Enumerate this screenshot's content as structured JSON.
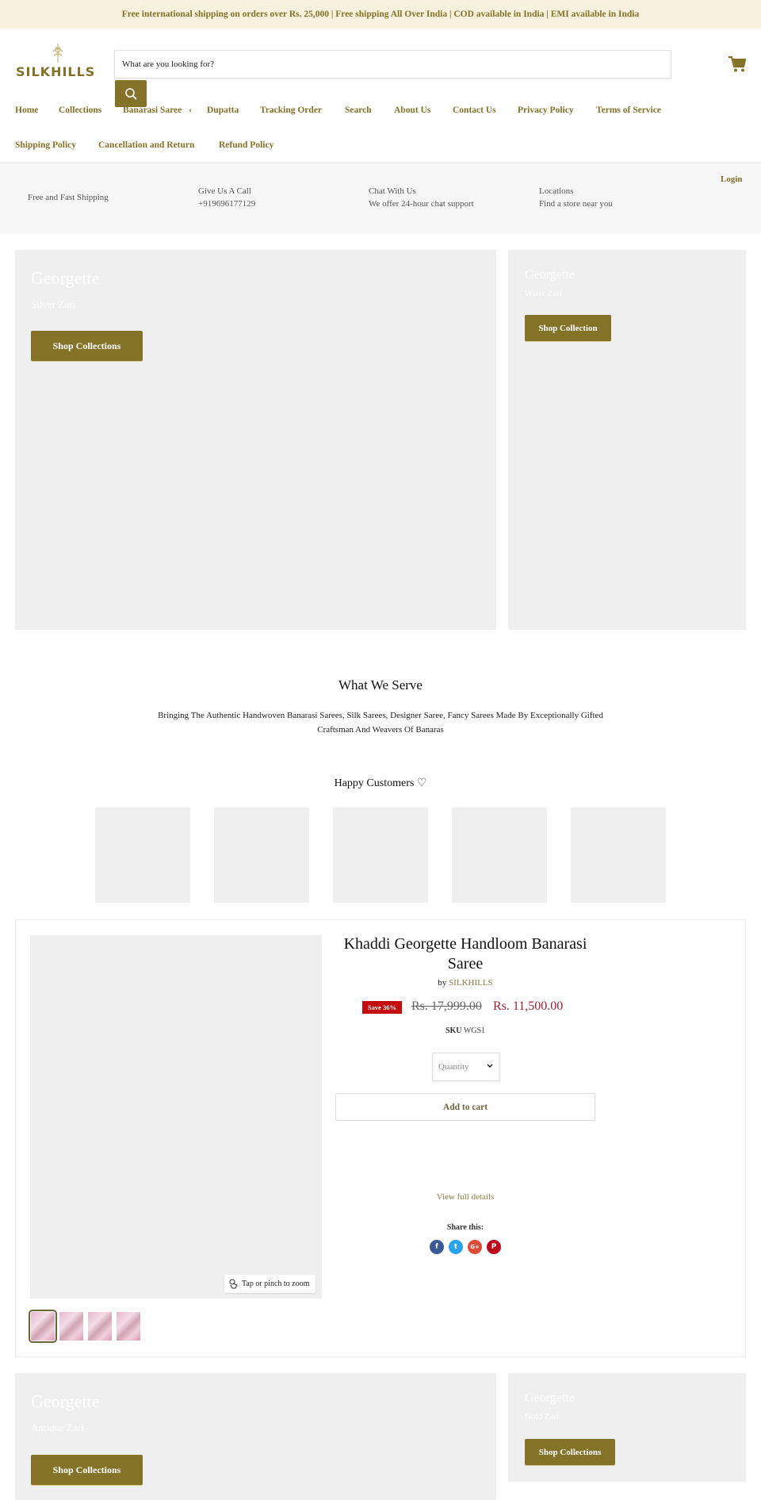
{
  "announcement": "Free international shipping on orders over Rs. 25,000 | Free shipping All Over India | COD available in India | EMI available in India",
  "brand": {
    "name": "SILKHILLS",
    "color": "#857229"
  },
  "search": {
    "placeholder": "What are you looking for?",
    "value": ""
  },
  "nav": {
    "items": [
      {
        "label": "Home"
      },
      {
        "label": "Collections"
      },
      {
        "label": "Banarasi Saree",
        "has_submenu": true,
        "submenu_glyph": "‹"
      },
      {
        "label": "Dupatta"
      },
      {
        "label": "Tracking Order"
      },
      {
        "label": "Search"
      },
      {
        "label": "About Us"
      },
      {
        "label": "Contact Us"
      },
      {
        "label": "Privacy Policy"
      },
      {
        "label": "Terms of Service"
      },
      {
        "label": "Shipping Policy"
      },
      {
        "label": "Cancellation and Return"
      },
      {
        "label": "Refund Policy"
      }
    ]
  },
  "infobar": {
    "items": [
      {
        "title": "Free and Fast Shipping",
        "subtitle": ""
      },
      {
        "title": "Give Us A Call",
        "subtitle": "+919696177129"
      },
      {
        "title": "Chat With Us",
        "subtitle": "We offer 24-hour chat support"
      },
      {
        "title": "Locations",
        "subtitle": "Find a store near you"
      }
    ],
    "login_label": "Login"
  },
  "promos_top": [
    {
      "title": "Georgette",
      "subtitle": "Silver Zari",
      "button": "Shop Collections"
    },
    {
      "title": "Georgette",
      "subtitle": "Water Zari",
      "button": "Shop Collection"
    }
  ],
  "what_we_serve": {
    "title": "What We Serve",
    "text": "Bringing The Authentic Handwoven Banarasi Sarees, Silk Sarees, Designer Saree, Fancy Sarees Made By Exceptionally Gifted Craftsman And Weavers Of Banaras"
  },
  "happy_customers": {
    "title": "Happy Customers ♡",
    "count": 5
  },
  "product": {
    "title": "Khaddi Georgette Handloom Banarasi Saree",
    "by_label": "by",
    "vendor": "SILKHILLS",
    "save_badge": "Save 36%",
    "compare_price": "Rs. 17,999.00",
    "price": "Rs. 11,500.00",
    "sku_label": "SKU",
    "sku": "WGS1",
    "quantity_placeholder": "Quantity",
    "add_to_cart": "Add to cart",
    "view_details": "View full details",
    "share_label": "Share this:",
    "zoom_hint": "Tap or pinch to zoom",
    "thumbnails": 4,
    "active_thumbnail": 1,
    "share": [
      {
        "network": "facebook",
        "glyph": "f",
        "color": "#3b5998"
      },
      {
        "network": "twitter",
        "glyph": "t",
        "color": "#2aa3ef"
      },
      {
        "network": "google-plus",
        "glyph": "G+",
        "color": "#dd4b39"
      },
      {
        "network": "pinterest",
        "glyph": "P",
        "color": "#bd081c"
      }
    ]
  },
  "promos_bottom": [
    {
      "title": "Georgette",
      "subtitle": "Antique Zari",
      "button": "Shop Collections"
    },
    {
      "title": "Georgette",
      "subtitle": "Gold Zari",
      "button": "Shop Collections"
    }
  ]
}
